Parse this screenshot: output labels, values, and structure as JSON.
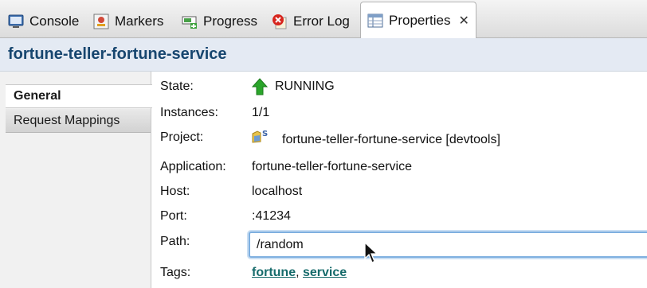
{
  "tabs": [
    {
      "label": "Console",
      "icon": "console-icon"
    },
    {
      "label": "Markers",
      "icon": "markers-icon"
    },
    {
      "label": "Progress",
      "icon": "progress-icon"
    },
    {
      "label": "Error Log",
      "icon": "error-log-icon"
    },
    {
      "label": "Properties",
      "icon": "properties-icon",
      "active": true
    }
  ],
  "title": "fortune-teller-fortune-service",
  "side_tabs": {
    "general": "General",
    "request_mappings": "Request Mappings"
  },
  "properties": {
    "state": {
      "label": "State:",
      "value": "RUNNING",
      "icon": "running-arrow-up-icon",
      "icon_color": "#2aa52a"
    },
    "instances": {
      "label": "Instances:",
      "value": "1/1"
    },
    "project": {
      "label": "Project:",
      "value": "fortune-teller-fortune-service [devtools]",
      "icon": "spring-project-icon"
    },
    "application": {
      "label": "Application:",
      "value": "fortune-teller-fortune-service"
    },
    "host": {
      "label": "Host:",
      "value": "localhost"
    },
    "port": {
      "label": "Port:",
      "value": ":41234"
    },
    "path": {
      "label": "Path:",
      "value": "/random"
    },
    "tags": {
      "label": "Tags:",
      "items": [
        "fortune",
        "service"
      ],
      "separator": ", "
    }
  },
  "colors": {
    "title_text": "#17466f",
    "title_bg": "#e4eaf3",
    "tag_link": "#166b6b",
    "input_focus": "#7fb0e0"
  }
}
